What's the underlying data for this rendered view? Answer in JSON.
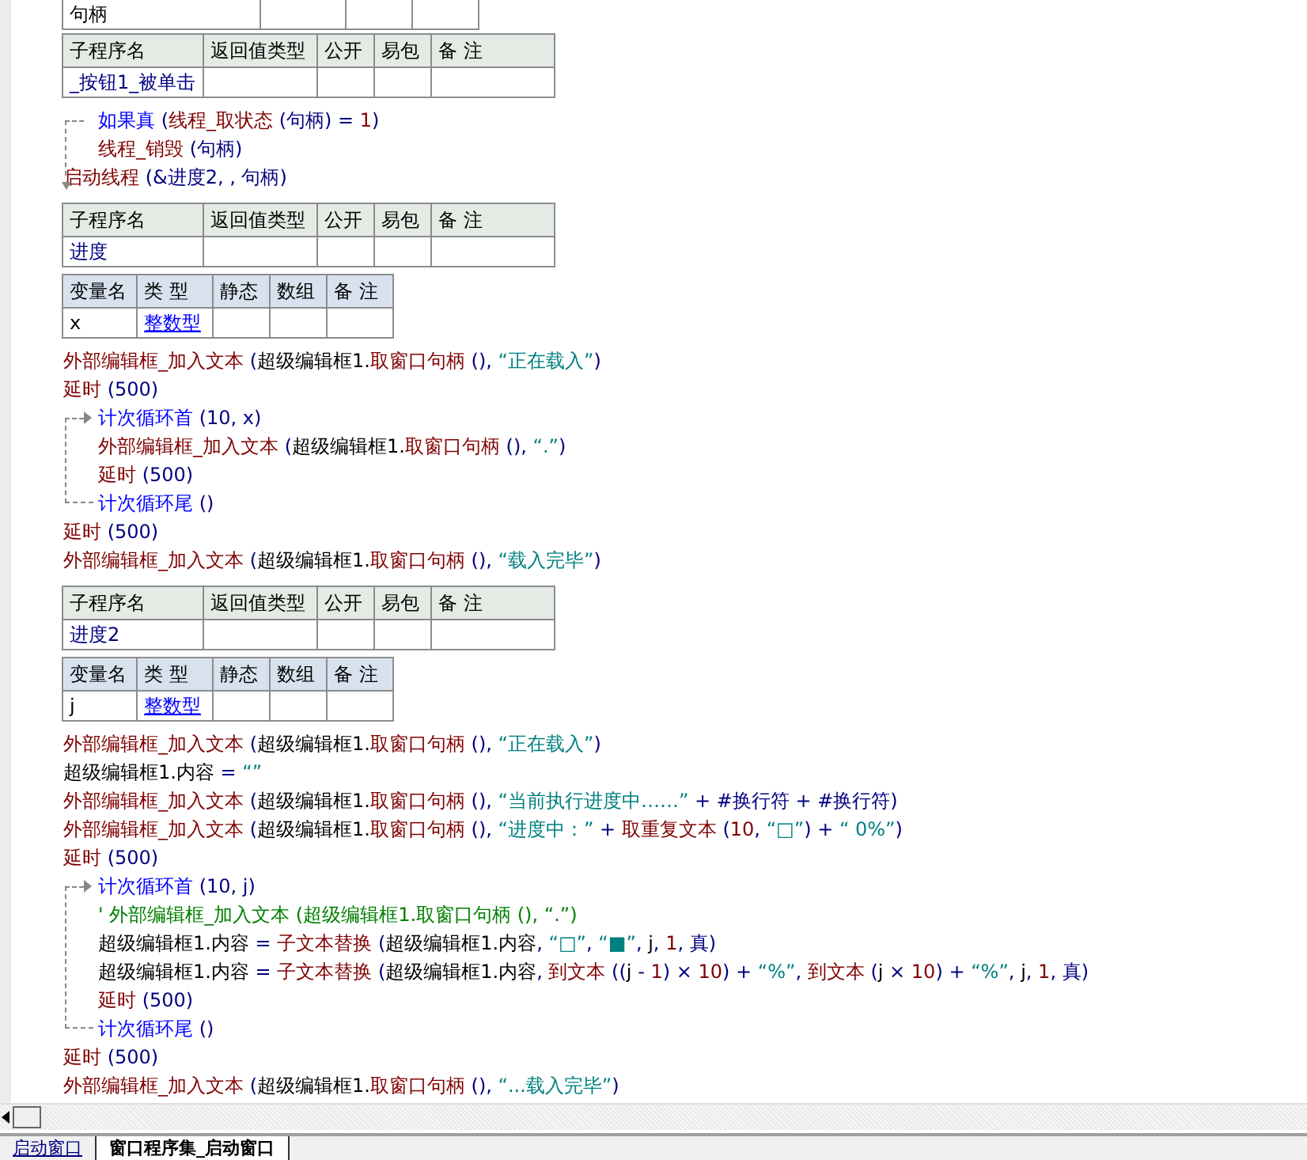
{
  "partial_table": {
    "cells": [
      "句柄"
    ]
  },
  "sections": [
    {
      "kind": "sub",
      "columns": [
        "子程序名",
        "返回值类型",
        "公开",
        "易包",
        "备 注"
      ],
      "row": {
        "name": "_按钮1_被单击"
      }
    },
    {
      "kind": "code",
      "lines": [
        {
          "kind": "if",
          "head": [
            {
              "kind": "flow",
              "text": "如果真"
            },
            {
              "kind": "op",
              "text": " ("
            },
            {
              "kind": "fn",
              "text": "线程_取状态"
            },
            {
              "kind": "op",
              "text": " (句柄) = "
            },
            {
              "kind": "num",
              "text": "1"
            },
            {
              "kind": "op",
              "text": ")"
            }
          ],
          "children": [
            [
              {
                "kind": "fn",
                "text": "线程_销毁"
              },
              {
                "kind": "op",
                "text": " (句柄)"
              }
            ]
          ]
        },
        {
          "kind": "line",
          "tokens": [
            {
              "kind": "fn",
              "text": "启动线程"
            },
            {
              "kind": "op",
              "text": " (&进度2, , 句柄)"
            }
          ]
        }
      ]
    },
    {
      "kind": "sub",
      "columns": [
        "子程序名",
        "返回值类型",
        "公开",
        "易包",
        "备 注"
      ],
      "row": {
        "name": "进度"
      }
    },
    {
      "kind": "var",
      "columns": [
        "变量名",
        "类 型",
        "静态",
        "数组",
        "备 注"
      ],
      "row": {
        "name": "x",
        "type": "整数型"
      }
    },
    {
      "kind": "code",
      "lines": [
        {
          "kind": "line",
          "tokens": [
            {
              "kind": "fn",
              "text": "外部编辑框_加入文本"
            },
            {
              "kind": "op",
              "text": " ("
            },
            {
              "kind": "obj",
              "text": "超级编辑框1."
            },
            {
              "kind": "fn",
              "text": "取窗口句柄"
            },
            {
              "kind": "op",
              "text": " (), "
            },
            {
              "kind": "str",
              "text": "“正在载入”"
            },
            {
              "kind": "op",
              "text": ")"
            }
          ]
        },
        {
          "kind": "line",
          "tokens": [
            {
              "kind": "fn",
              "text": "延时"
            },
            {
              "kind": "op",
              "text": " (500)"
            }
          ]
        },
        {
          "kind": "loop",
          "head": [
            {
              "kind": "flow",
              "text": "计次循环首"
            },
            {
              "kind": "op",
              "text": " (10, x)"
            }
          ],
          "children": [
            [
              {
                "kind": "fn",
                "text": "外部编辑框_加入文本"
              },
              {
                "kind": "op",
                "text": " ("
              },
              {
                "kind": "obj",
                "text": "超级编辑框1."
              },
              {
                "kind": "fn",
                "text": "取窗口句柄"
              },
              {
                "kind": "op",
                "text": " (), "
              },
              {
                "kind": "str",
                "text": "“.”"
              },
              {
                "kind": "op",
                "text": ")"
              }
            ],
            [
              {
                "kind": "fn",
                "text": "延时"
              },
              {
                "kind": "op",
                "text": " (500)"
              }
            ]
          ],
          "tail": [
            {
              "kind": "flow",
              "text": "计次循环尾"
            },
            {
              "kind": "op",
              "text": " ()"
            }
          ]
        },
        {
          "kind": "line",
          "tokens": [
            {
              "kind": "fn",
              "text": "延时"
            },
            {
              "kind": "op",
              "text": " (500)"
            }
          ]
        },
        {
          "kind": "line",
          "tokens": [
            {
              "kind": "fn",
              "text": "外部编辑框_加入文本"
            },
            {
              "kind": "op",
              "text": " ("
            },
            {
              "kind": "obj",
              "text": "超级编辑框1."
            },
            {
              "kind": "fn",
              "text": "取窗口句柄"
            },
            {
              "kind": "op",
              "text": " (), "
            },
            {
              "kind": "str",
              "text": "“载入完毕”"
            },
            {
              "kind": "op",
              "text": ")"
            }
          ]
        }
      ]
    },
    {
      "kind": "sub",
      "columns": [
        "子程序名",
        "返回值类型",
        "公开",
        "易包",
        "备 注"
      ],
      "row": {
        "name": "进度2"
      }
    },
    {
      "kind": "var",
      "columns": [
        "变量名",
        "类 型",
        "静态",
        "数组",
        "备 注"
      ],
      "row": {
        "name": "j",
        "type": "整数型"
      }
    },
    {
      "kind": "code",
      "lines": [
        {
          "kind": "line",
          "tokens": [
            {
              "kind": "fn",
              "text": "外部编辑框_加入文本"
            },
            {
              "kind": "op",
              "text": " ("
            },
            {
              "kind": "obj",
              "text": "超级编辑框1."
            },
            {
              "kind": "fn",
              "text": "取窗口句柄"
            },
            {
              "kind": "op",
              "text": " (), "
            },
            {
              "kind": "str",
              "text": "“正在载入”"
            },
            {
              "kind": "op",
              "text": ")"
            }
          ]
        },
        {
          "kind": "line",
          "tokens": [
            {
              "kind": "obj",
              "text": "超级编辑框1.内容"
            },
            {
              "kind": "op",
              "text": " = "
            },
            {
              "kind": "str",
              "text": "“”"
            }
          ]
        },
        {
          "kind": "line",
          "tokens": [
            {
              "kind": "fn",
              "text": "外部编辑框_加入文本"
            },
            {
              "kind": "op",
              "text": " ("
            },
            {
              "kind": "obj",
              "text": "超级编辑框1."
            },
            {
              "kind": "fn",
              "text": "取窗口句柄"
            },
            {
              "kind": "op",
              "text": " (), "
            },
            {
              "kind": "str",
              "text": "“当前执行进度中……”"
            },
            {
              "kind": "op",
              "text": " + #换行符 + #换行符)"
            }
          ]
        },
        {
          "kind": "line",
          "tokens": [
            {
              "kind": "fn",
              "text": "外部编辑框_加入文本"
            },
            {
              "kind": "op",
              "text": " ("
            },
            {
              "kind": "obj",
              "text": "超级编辑框1."
            },
            {
              "kind": "fn",
              "text": "取窗口句柄"
            },
            {
              "kind": "op",
              "text": " (), "
            },
            {
              "kind": "str",
              "text": "“进度中：”"
            },
            {
              "kind": "op",
              "text": " + "
            },
            {
              "kind": "fn",
              "text": "取重复文本"
            },
            {
              "kind": "op",
              "text": " ("
            },
            {
              "kind": "num",
              "text": "10"
            },
            {
              "kind": "op",
              "text": ", "
            },
            {
              "kind": "str",
              "text": "“□”"
            },
            {
              "kind": "op",
              "text": ") + "
            },
            {
              "kind": "str",
              "text": "“ 0%”"
            },
            {
              "kind": "op",
              "text": ")"
            }
          ]
        },
        {
          "kind": "line",
          "tokens": [
            {
              "kind": "fn",
              "text": "延时"
            },
            {
              "kind": "op",
              "text": " (500)"
            }
          ]
        },
        {
          "kind": "loop",
          "head": [
            {
              "kind": "flow",
              "text": "计次循环首"
            },
            {
              "kind": "op",
              "text": " (10, j)"
            }
          ],
          "children": [
            [
              {
                "kind": "comment",
                "text": "' 外部编辑框_加入文本 (超级编辑框1.取窗口句柄 (), “.”)"
              }
            ],
            [
              {
                "kind": "obj",
                "text": "超级编辑框1.内容"
              },
              {
                "kind": "op",
                "text": " = "
              },
              {
                "kind": "fn",
                "text": "子文本替换"
              },
              {
                "kind": "op",
                "text": " ("
              },
              {
                "kind": "obj",
                "text": "超级编辑框1.内容"
              },
              {
                "kind": "op",
                "text": ", "
              },
              {
                "kind": "str",
                "text": "“□”"
              },
              {
                "kind": "op",
                "text": ", "
              },
              {
                "kind": "str",
                "text": "“■”"
              },
              {
                "kind": "op",
                "text": ", "
              },
              {
                "kind": "obj",
                "text": "j"
              },
              {
                "kind": "op",
                "text": ", "
              },
              {
                "kind": "num",
                "text": "1"
              },
              {
                "kind": "op",
                "text": ", 真)"
              }
            ],
            [
              {
                "kind": "obj",
                "text": "超级编辑框1.内容"
              },
              {
                "kind": "op",
                "text": " = "
              },
              {
                "kind": "fn",
                "text": "子文本替换"
              },
              {
                "kind": "op",
                "text": " ("
              },
              {
                "kind": "obj",
                "text": "超级编辑框1.内容"
              },
              {
                "kind": "op",
                "text": ", "
              },
              {
                "kind": "fn",
                "text": "到文本"
              },
              {
                "kind": "op",
                "text": " (("
              },
              {
                "kind": "obj",
                "text": "j"
              },
              {
                "kind": "op",
                "text": " - "
              },
              {
                "kind": "num",
                "text": "1"
              },
              {
                "kind": "op",
                "text": ") × "
              },
              {
                "kind": "num",
                "text": "10"
              },
              {
                "kind": "op",
                "text": ") + "
              },
              {
                "kind": "str",
                "text": "“%”"
              },
              {
                "kind": "op",
                "text": ", "
              },
              {
                "kind": "fn",
                "text": "到文本"
              },
              {
                "kind": "op",
                "text": " ("
              },
              {
                "kind": "obj",
                "text": "j"
              },
              {
                "kind": "op",
                "text": " × "
              },
              {
                "kind": "num",
                "text": "10"
              },
              {
                "kind": "op",
                "text": ") + "
              },
              {
                "kind": "str",
                "text": "“%”"
              },
              {
                "kind": "op",
                "text": ", "
              },
              {
                "kind": "obj",
                "text": "j"
              },
              {
                "kind": "op",
                "text": ", "
              },
              {
                "kind": "num",
                "text": "1"
              },
              {
                "kind": "op",
                "text": ", 真)"
              }
            ],
            [
              {
                "kind": "fn",
                "text": "延时"
              },
              {
                "kind": "op",
                "text": " (500)"
              }
            ]
          ],
          "tail": [
            {
              "kind": "flow",
              "text": "计次循环尾"
            },
            {
              "kind": "op",
              "text": " ()"
            }
          ]
        },
        {
          "kind": "line",
          "tokens": [
            {
              "kind": "fn",
              "text": "延时"
            },
            {
              "kind": "op",
              "text": " (500)"
            }
          ]
        },
        {
          "kind": "line",
          "tokens": [
            {
              "kind": "fn",
              "text": "外部编辑框_加入文本"
            },
            {
              "kind": "op",
              "text": " ("
            },
            {
              "kind": "obj",
              "text": "超级编辑框1."
            },
            {
              "kind": "fn",
              "text": "取窗口句柄"
            },
            {
              "kind": "op",
              "text": " (), "
            },
            {
              "kind": "str",
              "text": "“...载入完毕”"
            },
            {
              "kind": "op",
              "text": ")"
            }
          ]
        }
      ]
    }
  ],
  "tabs": [
    {
      "label": "启动窗口",
      "selected": false
    },
    {
      "label": "窗口程序集_启动窗口",
      "selected": true
    }
  ]
}
